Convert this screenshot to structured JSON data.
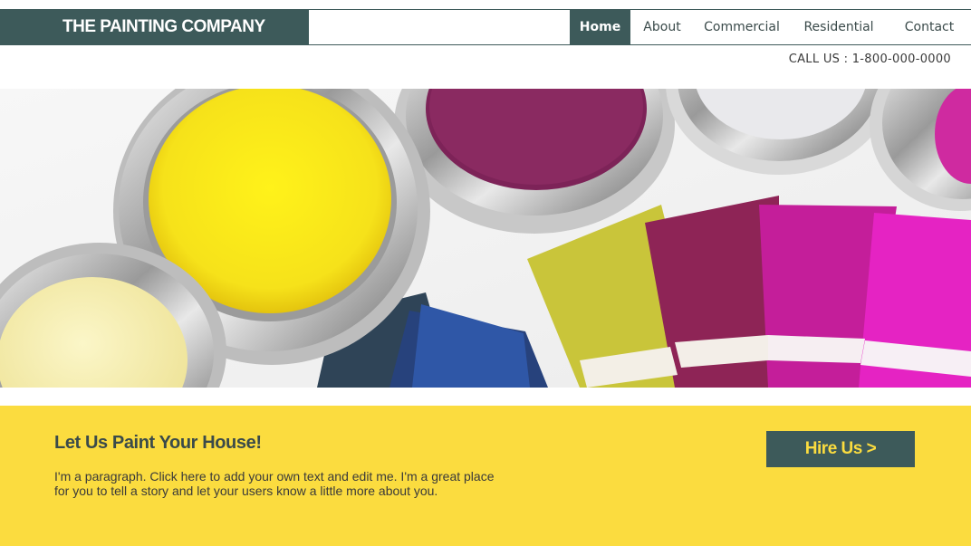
{
  "header": {
    "logo_text": "THE PAINTING COMPANY",
    "nav": [
      {
        "label": "Home",
        "active": true
      },
      {
        "label": "About",
        "active": false
      },
      {
        "label": "Commercial",
        "active": false
      },
      {
        "label": "Residential",
        "active": false
      },
      {
        "label": "Contact",
        "active": false
      }
    ],
    "call_us": "CALL US : 1-800-000-0000"
  },
  "hero": {
    "image": "paint-cans-and-swatches"
  },
  "band": {
    "title": "Let Us Paint Your House!",
    "paragraph": "I'm a paragraph. Click here to add your own text and edit me. I'm a great place for you to tell a story and let your users know a little more about you.",
    "button_label": "Hire Us >"
  },
  "colors": {
    "brand_dark": "#3d5a5a",
    "band_yellow": "#fbdc3f"
  }
}
